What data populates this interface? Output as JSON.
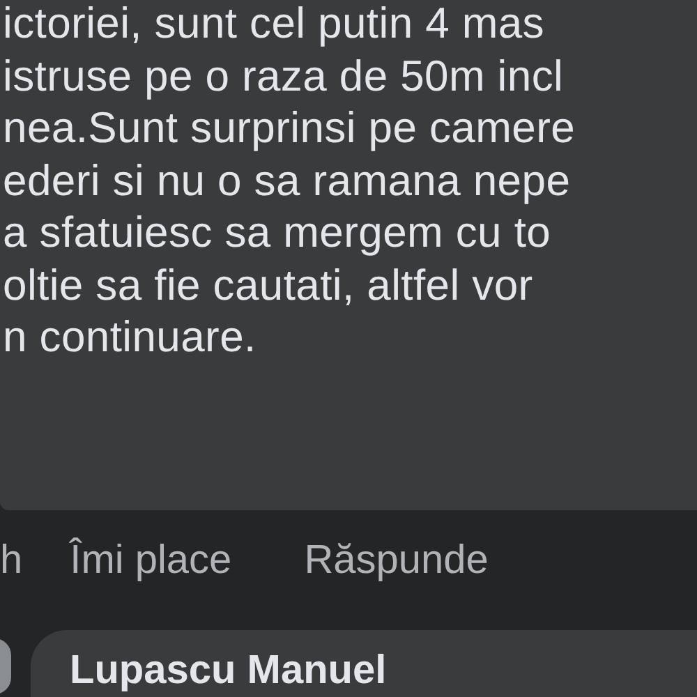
{
  "comment": {
    "lines": [
      "ictoriei, sunt cel putin 4 mas",
      "istruse pe o raza de 50m incl",
      "nea.Sunt surprinsi pe camere",
      "ederi si nu o sa ramana nepe",
      "a sfatuiesc sa mergem cu to",
      "oltie sa fie cautati, altfel vor",
      "n continuare."
    ]
  },
  "actions": {
    "time": "h",
    "like": "Îmi place",
    "reply": "Răspunde"
  },
  "next_comment": {
    "author": "Lupascu Manuel"
  }
}
